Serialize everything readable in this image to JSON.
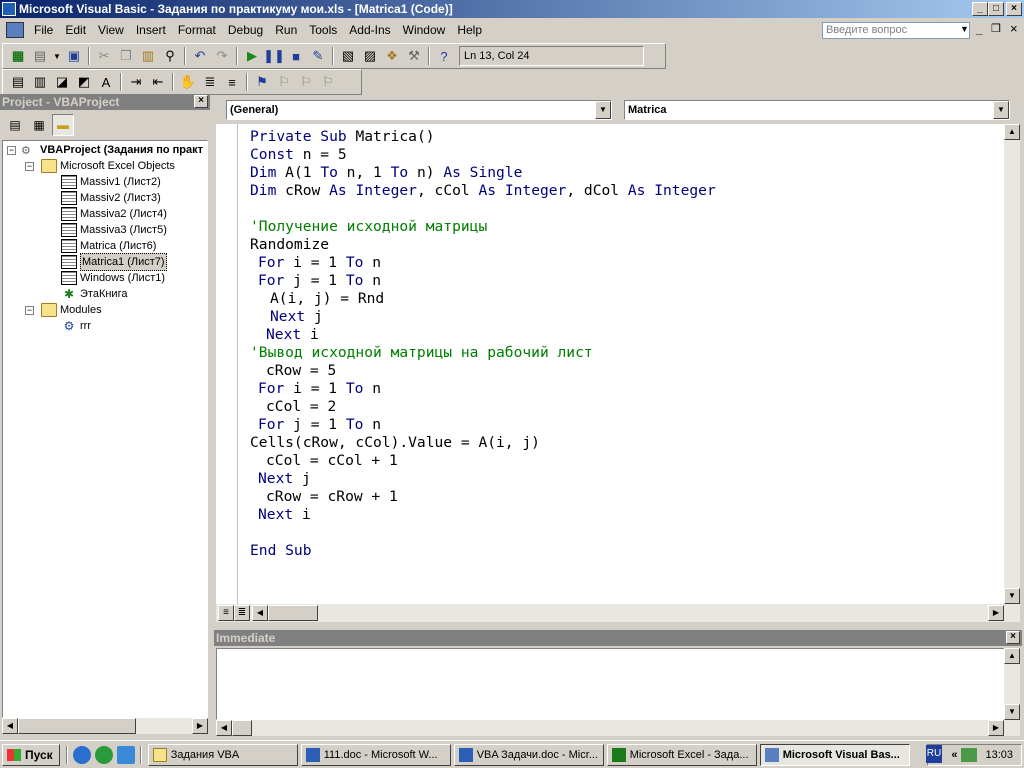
{
  "window": {
    "title": "Microsoft Visual Basic - Задания по практикуму мои.xls - [Matrica1 (Code)]",
    "min_glyph": "_",
    "max_glyph": "□",
    "close_glyph": "×"
  },
  "menu": {
    "items": [
      "File",
      "Edit",
      "View",
      "Insert",
      "Format",
      "Debug",
      "Run",
      "Tools",
      "Add-Ins",
      "Window",
      "Help"
    ],
    "ask_placeholder": "Введите вопрос"
  },
  "toolbar": {
    "cursor_position": "Ln 13, Col 24"
  },
  "project_panel": {
    "title": "Project - VBAProject",
    "root": "VBAProject (Задания по практ",
    "folder_excel_objects": "Microsoft Excel Objects",
    "sheets": [
      "Massiv1 (Лист2)",
      "Massiv2 (Лист3)",
      "Massiva2 (Лист4)",
      "Massiva3 (Лист5)",
      "Matrica (Лист6)",
      "Matrica1 (Лист7)",
      "Windows (Лист1)",
      "ЭтаКнига"
    ],
    "folder_modules": "Modules",
    "modules": [
      "rrr"
    ]
  },
  "code_window": {
    "object_combo": "(General)",
    "proc_combo": "Matrica",
    "lines": [
      {
        "indent": 0,
        "parts": [
          {
            "t": "Private Sub ",
            "k": "kw"
          },
          {
            "t": "Matrica()",
            "k": ""
          }
        ]
      },
      {
        "indent": 0,
        "parts": [
          {
            "t": "Const ",
            "k": "kw"
          },
          {
            "t": "n = 5",
            "k": ""
          }
        ]
      },
      {
        "indent": 0,
        "parts": [
          {
            "t": "Dim ",
            "k": "kw"
          },
          {
            "t": "A(1 ",
            "k": ""
          },
          {
            "t": "To ",
            "k": "kw"
          },
          {
            "t": "n, 1 ",
            "k": ""
          },
          {
            "t": "To ",
            "k": "kw"
          },
          {
            "t": "n) ",
            "k": ""
          },
          {
            "t": "As Single",
            "k": "kw"
          }
        ]
      },
      {
        "indent": 0,
        "parts": [
          {
            "t": "Dim ",
            "k": "kw"
          },
          {
            "t": "cRow ",
            "k": ""
          },
          {
            "t": "As Integer",
            "k": "kw"
          },
          {
            "t": ", cCol ",
            "k": ""
          },
          {
            "t": "As Integer",
            "k": "kw"
          },
          {
            "t": ", dCol ",
            "k": ""
          },
          {
            "t": "As Integer",
            "k": "kw"
          }
        ]
      },
      {
        "indent": 0,
        "parts": []
      },
      {
        "indent": 0,
        "parts": [
          {
            "t": "'Получение исходной матрицы",
            "k": "cm"
          }
        ]
      },
      {
        "indent": 0,
        "parts": [
          {
            "t": "Randomize",
            "k": ""
          }
        ]
      },
      {
        "indent": 2,
        "parts": [
          {
            "t": "For ",
            "k": "kw"
          },
          {
            "t": "i = 1 ",
            "k": ""
          },
          {
            "t": "To ",
            "k": "kw"
          },
          {
            "t": "n",
            "k": ""
          }
        ]
      },
      {
        "indent": 2,
        "parts": [
          {
            "t": "For ",
            "k": "kw"
          },
          {
            "t": "j = 1 ",
            "k": ""
          },
          {
            "t": "To ",
            "k": "kw"
          },
          {
            "t": "n",
            "k": ""
          }
        ]
      },
      {
        "indent": 5,
        "parts": [
          {
            "t": "A(i, j) = Rnd",
            "k": ""
          }
        ]
      },
      {
        "indent": 5,
        "parts": [
          {
            "t": "Next ",
            "k": "kw"
          },
          {
            "t": "j",
            "k": ""
          }
        ]
      },
      {
        "indent": 4,
        "parts": [
          {
            "t": "Next ",
            "k": "kw"
          },
          {
            "t": "i",
            "k": ""
          }
        ]
      },
      {
        "indent": 0,
        "parts": [
          {
            "t": "'Вывод исходной матрицы на рабочий лист",
            "k": "cm"
          }
        ]
      },
      {
        "indent": 4,
        "parts": [
          {
            "t": "cRow = 5",
            "k": ""
          }
        ]
      },
      {
        "indent": 2,
        "parts": [
          {
            "t": "For ",
            "k": "kw"
          },
          {
            "t": "i = 1 ",
            "k": ""
          },
          {
            "t": "To ",
            "k": "kw"
          },
          {
            "t": "n",
            "k": ""
          }
        ]
      },
      {
        "indent": 4,
        "parts": [
          {
            "t": "cCol = 2",
            "k": ""
          }
        ]
      },
      {
        "indent": 2,
        "parts": [
          {
            "t": "For ",
            "k": "kw"
          },
          {
            "t": "j = 1 ",
            "k": ""
          },
          {
            "t": "To ",
            "k": "kw"
          },
          {
            "t": "n",
            "k": ""
          }
        ]
      },
      {
        "indent": 0,
        "parts": [
          {
            "t": "Cells(cRow, cCol).Value = A(i, j)",
            "k": ""
          }
        ]
      },
      {
        "indent": 4,
        "parts": [
          {
            "t": "cCol = cCol + 1",
            "k": ""
          }
        ]
      },
      {
        "indent": 2,
        "parts": [
          {
            "t": "Next ",
            "k": "kw"
          },
          {
            "t": "j",
            "k": ""
          }
        ]
      },
      {
        "indent": 4,
        "parts": [
          {
            "t": "cRow = cRow + 1",
            "k": ""
          }
        ]
      },
      {
        "indent": 2,
        "parts": [
          {
            "t": "Next ",
            "k": "kw"
          },
          {
            "t": "i",
            "k": ""
          }
        ]
      },
      {
        "indent": 0,
        "parts": []
      },
      {
        "indent": 0,
        "parts": [
          {
            "t": "End Sub",
            "k": "kw"
          }
        ]
      }
    ]
  },
  "immediate": {
    "title": "Immediate"
  },
  "taskbar": {
    "start_label": "Пуск",
    "buttons": [
      {
        "label": "Задания VBA",
        "icon": "folder-icon",
        "active": false
      },
      {
        "label": "111.doc - Microsoft W...",
        "icon": "word-icon",
        "active": false
      },
      {
        "label": "VBA Задачи.doc - Micr...",
        "icon": "word-icon",
        "active": false
      },
      {
        "label": "Microsoft Excel - Зада...",
        "icon": "excel-icon",
        "active": false
      },
      {
        "label": "Microsoft Visual Bas...",
        "icon": "vb-icon",
        "active": true
      }
    ],
    "lang": "RU",
    "tray_expand": "«",
    "clock": "13:03"
  },
  "colors": {
    "keyword": "#00007f",
    "comment": "#007f00",
    "titlebar_start": "#0a246a",
    "titlebar_end": "#a6caf0",
    "face": "#d4d0c8"
  }
}
